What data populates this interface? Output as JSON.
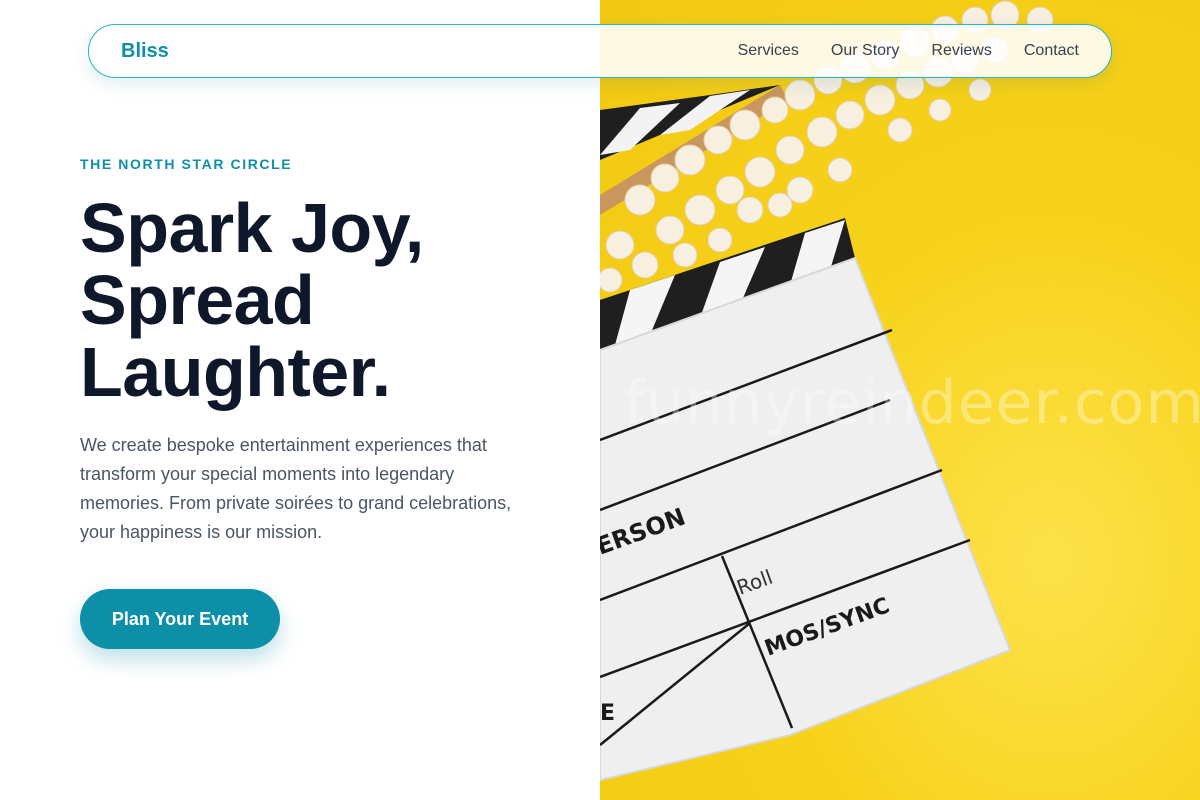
{
  "nav": {
    "brand": "Bliss",
    "links": [
      "Services",
      "Our Story",
      "Reviews",
      "Contact"
    ]
  },
  "hero": {
    "eyebrow": "THE NORTH STAR CIRCLE",
    "headline": [
      "Spark Joy,",
      "Spread",
      "Laughter."
    ],
    "body": "We create bespoke entertainment experiences that transform your special moments into legendary memories. From private soirées to grand celebrations, your happiness is our mission.",
    "cta": "Plan Your Event"
  },
  "photo": {
    "subject": "clapperboard-with-popcorn",
    "clapper_text": [
      "ERSON",
      "Roll",
      "MOS/SYNC",
      "E"
    ],
    "watermark": "funnyreindeer.com"
  },
  "colors": {
    "accent": "#0e8fa8",
    "nav_border": "#22b8c8",
    "heading": "#0f172a",
    "body_text": "#4b5563",
    "photo_background": "#f7d21a"
  }
}
